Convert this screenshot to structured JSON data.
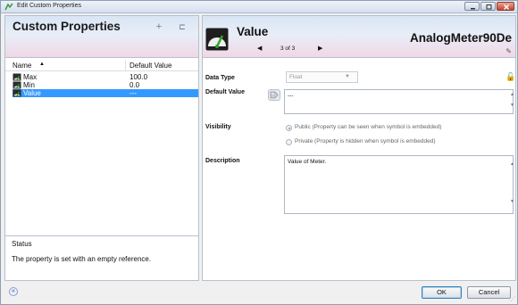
{
  "window": {
    "title": "Edit Custom Properties",
    "controls": {
      "minimize": "minimize",
      "maximize": "maximize",
      "close": "close"
    }
  },
  "left_panel": {
    "title": "Custom Properties",
    "add_icon": "+",
    "remove_icon": "⊏",
    "columns": {
      "name": "Name",
      "default_value": "Default Value"
    },
    "rows": [
      {
        "name": "Max",
        "value": "100.0",
        "selected": false
      },
      {
        "name": "Min",
        "value": "0.0",
        "selected": false
      },
      {
        "name": "Value",
        "value": "---",
        "selected": true
      }
    ],
    "status": {
      "label": "Status",
      "message": "The property is set with an empty reference."
    }
  },
  "right_panel": {
    "title": "Value",
    "symbol_name": "AnalogMeter90De",
    "nav": {
      "prev": "◀",
      "count": "3 of 3",
      "next": "▶"
    },
    "fields": {
      "data_type_label": "Data Type",
      "data_type_value": "Float",
      "default_value_label": "Default Value",
      "default_value": "---",
      "visibility_label": "Visibility",
      "visibility_public": "Public (Property can be seen when symbol is embedded)",
      "visibility_private": "Private (Property is hidden when symbol is embedded)",
      "description_label": "Description",
      "description_value": "Value of Meter."
    }
  },
  "footer": {
    "collapse_icon": "«",
    "ok": "OK",
    "cancel": "Cancel"
  },
  "colors": {
    "selection": "#3399ff",
    "header_gradient_top": "#d9e5f4",
    "header_gradient_bottom": "#f1d7e6",
    "close_button": "#c4452d"
  }
}
